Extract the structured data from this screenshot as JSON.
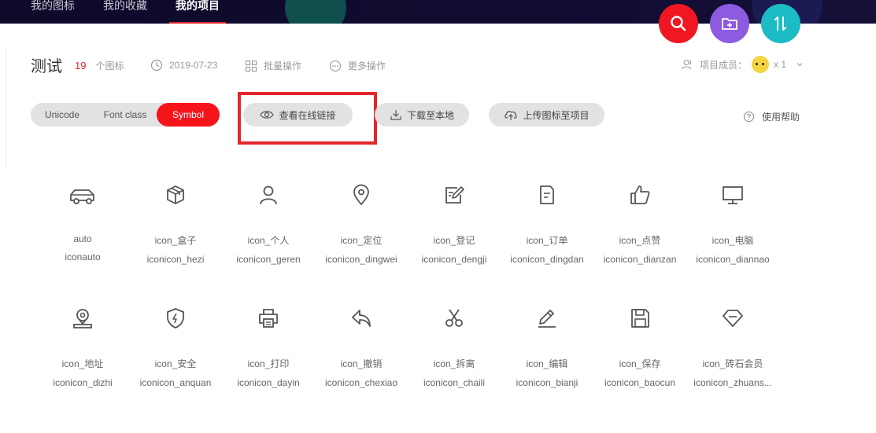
{
  "nav": {
    "tabs": [
      {
        "label": "我的图标"
      },
      {
        "label": "我的收藏"
      },
      {
        "label": "我的项目",
        "active": true
      }
    ]
  },
  "fabs": [
    {
      "icon": "search-icon",
      "color": "#f01622"
    },
    {
      "icon": "folder-add-icon",
      "color": "#8d5be0"
    },
    {
      "icon": "sort-icon",
      "color": "#1cbcc4"
    }
  ],
  "project": {
    "name": "测试",
    "count": "19",
    "count_unit": "个图标",
    "date": "2019-07-23",
    "batch_label": "批量操作",
    "more_label": "更多操作",
    "members_label": "项目成员：",
    "members_count": "x 1"
  },
  "toolbar": {
    "formats": [
      "Unicode",
      "Font class",
      "Symbol"
    ],
    "active_format": "Symbol",
    "view_link": "查看在线链接",
    "download": "下载至本地",
    "upload": "上传图标至项目",
    "help": "使用帮助"
  },
  "icons": [
    {
      "name": "auto",
      "code": "iconauto",
      "icon": "car-icon"
    },
    {
      "name": "icon_盒子",
      "code": "iconicon_hezi",
      "icon": "box-icon"
    },
    {
      "name": "icon_个人",
      "code": "iconicon_geren",
      "icon": "user-icon"
    },
    {
      "name": "icon_定位",
      "code": "iconicon_dingwei",
      "icon": "location-pin-icon"
    },
    {
      "name": "icon_登记",
      "code": "iconicon_dengji",
      "icon": "register-icon"
    },
    {
      "name": "icon_订单",
      "code": "iconicon_dingdan",
      "icon": "order-icon"
    },
    {
      "name": "icon_点赞",
      "code": "iconicon_dianzan",
      "icon": "thumbs-up-icon"
    },
    {
      "name": "icon_电脑",
      "code": "iconicon_diannao",
      "icon": "monitor-icon"
    },
    {
      "name": "icon_地址",
      "code": "iconicon_dizhi",
      "icon": "address-icon"
    },
    {
      "name": "icon_安全",
      "code": "iconicon_anquan",
      "icon": "shield-icon"
    },
    {
      "name": "icon_打印",
      "code": "iconicon_dayin",
      "icon": "printer-icon"
    },
    {
      "name": "icon_撤销",
      "code": "iconicon_chexiao",
      "icon": "undo-icon"
    },
    {
      "name": "icon_拆离",
      "code": "iconicon_chaili",
      "icon": "scissors-icon"
    },
    {
      "name": "icon_编辑",
      "code": "iconicon_bianji",
      "icon": "edit-icon"
    },
    {
      "name": "icon_保存",
      "code": "iconicon_baocun",
      "icon": "save-icon"
    },
    {
      "name": "icon_砖石会员",
      "code": "iconicon_zhuans...",
      "icon": "diamond-icon"
    }
  ]
}
